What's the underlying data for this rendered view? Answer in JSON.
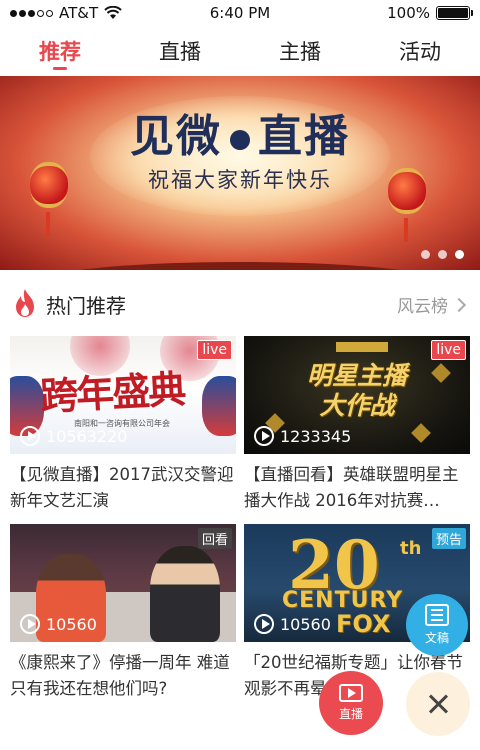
{
  "status_bar": {
    "carrier": "AT&T",
    "time": "6:40 PM",
    "battery": "100%",
    "battery_level": 1.0,
    "wifi_icon": "wifi-icon",
    "signal_bars": 3
  },
  "tabs": [
    {
      "label": "推荐",
      "active": true
    },
    {
      "label": "直播",
      "active": false
    },
    {
      "label": "主播",
      "active": false
    },
    {
      "label": "活动",
      "active": false
    }
  ],
  "banner": {
    "title_left": "见微",
    "title_right": "直播",
    "subtitle": "祝福大家新年快乐",
    "slide_count": 3,
    "active_slide": 3
  },
  "section": {
    "icon": "fire-icon",
    "title": "热门推荐",
    "link_label": "风云榜"
  },
  "cards": [
    {
      "badge": "live",
      "views": "10563220",
      "title": "【见微直播】2017武汉交警迎新年文艺汇演",
      "thumb_text": "跨年盛典",
      "thumb_sub": "南阳和一咨询有限公司年会"
    },
    {
      "badge": "live",
      "views": "1233345",
      "title": "【直播回看】英雄联盟明星主播大作战 2016年对抗赛…",
      "thumb_line1": "明星主播",
      "thumb_line2": "大作战"
    },
    {
      "badge": "回看",
      "views": "10560",
      "title": "《康熙来了》停播一周年 难道只有我还在想他们吗?"
    },
    {
      "badge": "预告",
      "views": "10560",
      "title": "「20世纪福斯专题」让你春节观影不再晕头绪",
      "thumb_big": "20",
      "thumb_th": "th",
      "thumb_century": "CENTURY",
      "thumb_fox": "FOX"
    }
  ],
  "floating": {
    "doc_label": "文稿",
    "live_label": "直播"
  },
  "colors": {
    "accent": "#e8474d",
    "doc_button": "#32b0e6",
    "close_button_bg": "#fdf1de"
  }
}
